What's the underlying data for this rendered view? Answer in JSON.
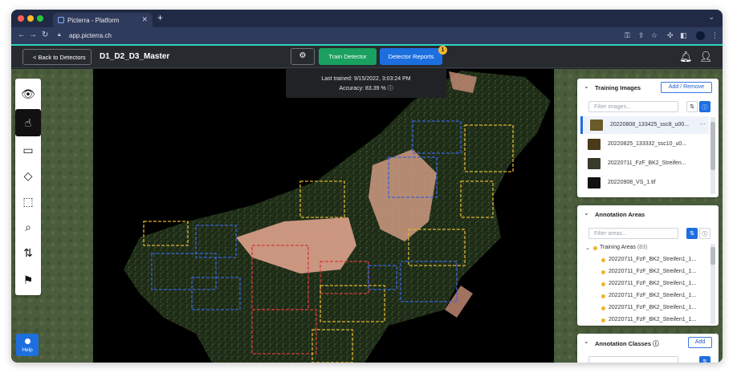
{
  "browser": {
    "tab_title": "Picterra - Platform",
    "url": "app.picterra.ch"
  },
  "header": {
    "back_label": "< Back to Detectors",
    "project_title": "D1_D2_D3_Master",
    "train_label": "Train Detector",
    "reports_label": "Detector Reports",
    "reports_badge": "1"
  },
  "tooltip": {
    "last_trained": "Last trained: 9/15/2022, 3:03:24 PM",
    "accuracy": "Accuracy: 83.39 %"
  },
  "help_label": "Help",
  "training_images": {
    "title": "Training Images",
    "add_remove_label": "Add / Remove",
    "filter_placeholder": "Filter images...",
    "items": [
      {
        "name": "20220808_133425_ssc8_u00..."
      },
      {
        "name": "20220825_133332_ssc10_u0..."
      },
      {
        "name": "20220711_FzF_BK2_Streifen..."
      },
      {
        "name": "20220908_VS_1.tif"
      }
    ]
  },
  "annotation_areas": {
    "title": "Annotation Areas",
    "filter_placeholder": "Filter areas...",
    "group_label": "Training Areas",
    "group_count": "(83)",
    "items": [
      {
        "name": "20220711_FzF_BK2_Streifen1_1..."
      },
      {
        "name": "20220711_FzF_BK2_Streifen1_1..."
      },
      {
        "name": "20220711_FzF_BK2_Streifen1_1..."
      },
      {
        "name": "20220711_FzF_BK2_Streifen1_1..."
      },
      {
        "name": "20220711_FzF_BK2_Streifen1_1..."
      },
      {
        "name": "20220711_FzF_BK2_Streifen1_1..."
      }
    ]
  },
  "annotation_classes": {
    "title": "Annotation Classes",
    "add_label": "Add"
  },
  "colors": {
    "accent_blue": "#1d6fe0",
    "train_green": "#1aa060",
    "teal_strip": "#2dd4bf",
    "area_dot": "#f0b429"
  }
}
